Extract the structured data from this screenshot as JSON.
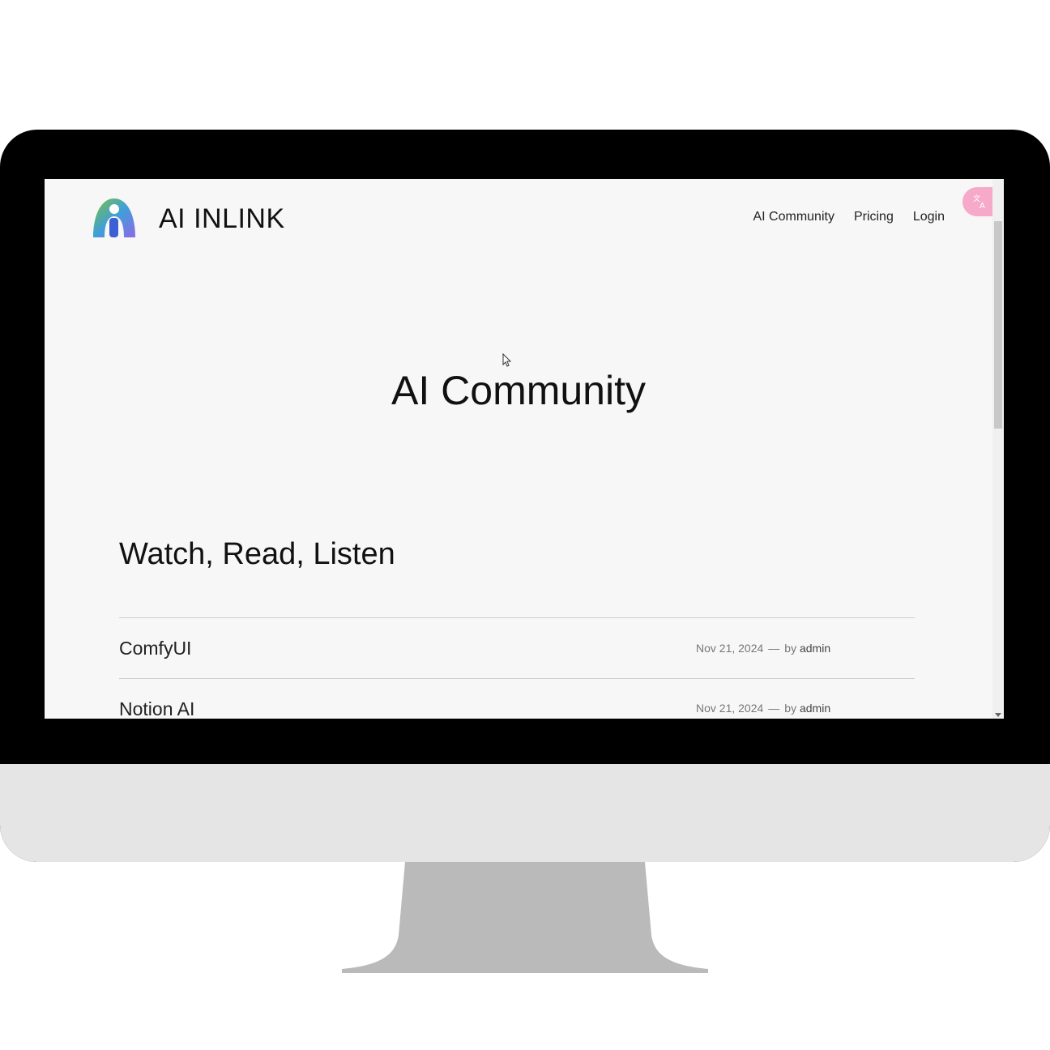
{
  "brand": {
    "name": "AI INLINK"
  },
  "nav": {
    "items": [
      "AI Community",
      "Pricing",
      "Login"
    ]
  },
  "hero": {
    "title": "AI Community"
  },
  "section": {
    "title": "Watch, Read, Listen"
  },
  "posts": [
    {
      "title": "ComfyUI",
      "date": "Nov 21, 2024",
      "separator": "—",
      "by": "by",
      "author": "admin"
    },
    {
      "title": "Notion AI",
      "date": "Nov 21, 2024",
      "separator": "—",
      "by": "by",
      "author": "admin"
    }
  ],
  "icons": {
    "translate": "translate-icon",
    "logo": "ai-inlink-logo"
  },
  "colors": {
    "accent_pink": "#f6a9c8",
    "logo_green": "#7cc33a",
    "logo_blue": "#3f7fe0",
    "logo_purple": "#8b6ae6"
  }
}
